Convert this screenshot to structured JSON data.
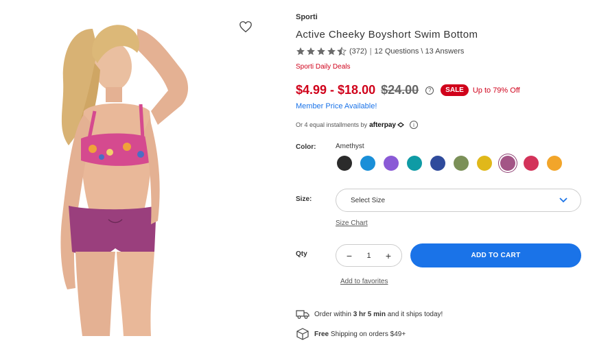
{
  "product": {
    "brand": "Sporti",
    "title": "Active Cheeky Boyshort Swim Bottom",
    "rating_stars": 4.5,
    "review_count": "(372)",
    "questions": "12 Questions \\ 13 Answers",
    "deals_label": "Sporti Daily Deals",
    "price_range": "$4.99 - $18.00",
    "price_was": "$24.00",
    "help_glyph": "?",
    "sale_badge": "SALE",
    "discount": "Up to 79% Off",
    "member_price": "Member Price Available!",
    "afterpay_text": "Or 4 equal installments by",
    "afterpay_brand": "afterpay",
    "info_glyph": "i"
  },
  "color": {
    "label": "Color:",
    "selected_name": "Amethyst",
    "swatches": [
      "#2b2b2b",
      "#1a8fd8",
      "#8a5ad6",
      "#0f9ba5",
      "#2f4b9c",
      "#7b9058",
      "#e0b81a",
      "#a35586",
      "#d3335a",
      "#f2a52a"
    ],
    "selected_index": 7
  },
  "size": {
    "label": "Size:",
    "placeholder": "Select Size",
    "chart_link": "Size Chart"
  },
  "qty": {
    "label": "Qty",
    "value": "1",
    "minus": "−",
    "plus": "+"
  },
  "actions": {
    "add_to_cart": "ADD TO CART",
    "add_to_favorites": "Add to favorites"
  },
  "shipping": {
    "order_prefix": "Order within",
    "order_time": "3 hr 5 min",
    "order_suffix": "and it ships today!",
    "free_label": "Free",
    "free_suffix": "Shipping on orders $49+"
  },
  "icons": [
    "heart-icon",
    "star-icon",
    "help-icon",
    "info-icon",
    "chevron-down-icon",
    "truck-icon",
    "box-icon"
  ]
}
